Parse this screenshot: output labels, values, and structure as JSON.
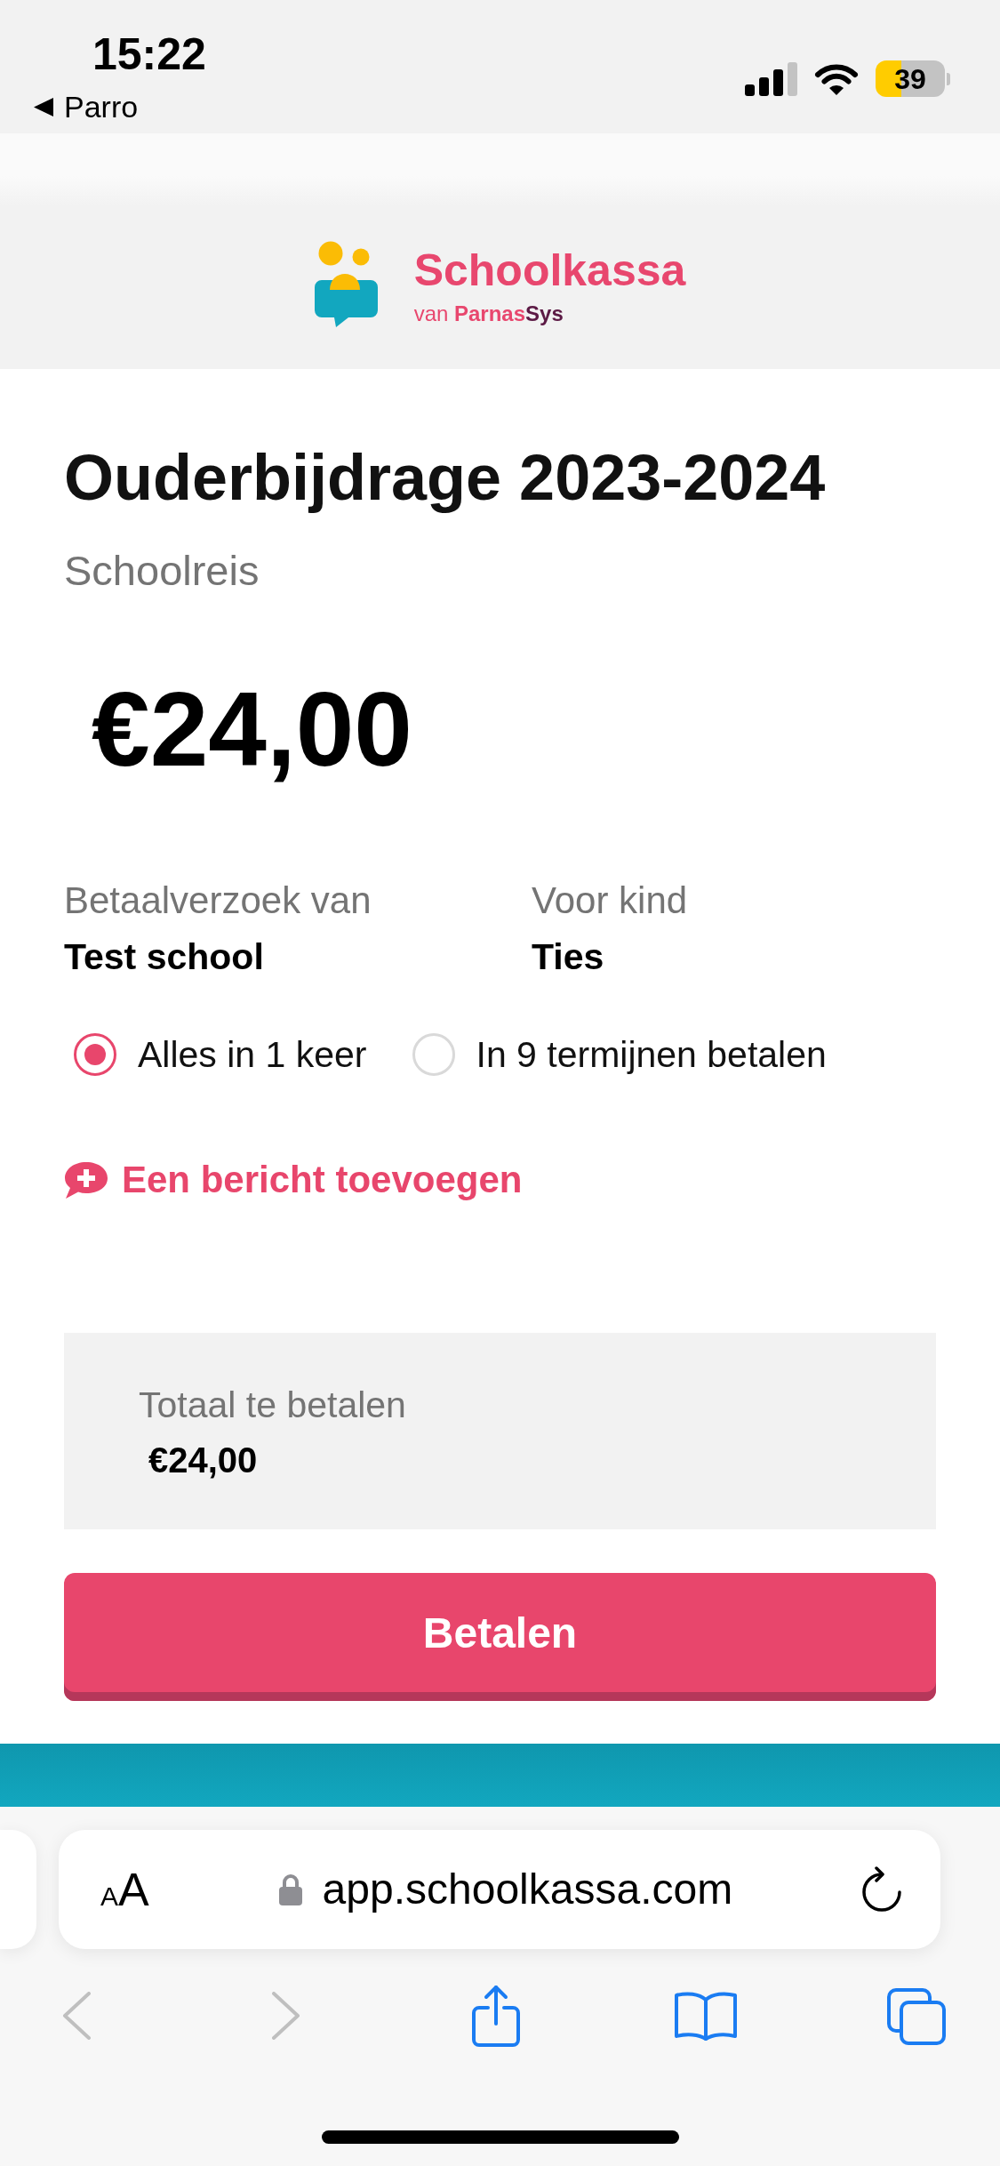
{
  "status_bar": {
    "time": "15:22",
    "back_app": "Parro",
    "battery": "39"
  },
  "header": {
    "brand": "Schoolkassa",
    "tagline": {
      "lead": "van",
      "brand": [
        "Parnas",
        "Sys"
      ]
    }
  },
  "payment": {
    "title": "Ouderbijdrage 2023-2024",
    "subtitle": "Schoolreis",
    "amount": "€24,00",
    "details": [
      {
        "label": "Betaalverzoek van",
        "value": "Test school"
      },
      {
        "label": "Voor kind",
        "value": "Ties"
      }
    ],
    "options": [
      {
        "label": "Alles in 1 keer",
        "selected": true
      },
      {
        "label": "In 9 termijnen betalen",
        "selected": false
      }
    ],
    "add_message": "Een bericht toevoegen",
    "total": {
      "label": "Totaal te betalen",
      "amount": "€24,00"
    },
    "pay_button": "Betalen"
  },
  "browser": {
    "text_size": [
      "A",
      "A"
    ],
    "url": "app.schoolkassa.com",
    "nav_buttons": [
      {
        "kind": "back",
        "disabled": true
      },
      {
        "kind": "forward",
        "disabled": true
      },
      {
        "kind": "share",
        "disabled": false
      },
      {
        "kind": "bookmarks",
        "disabled": false
      },
      {
        "kind": "tabs",
        "disabled": false
      }
    ]
  }
}
